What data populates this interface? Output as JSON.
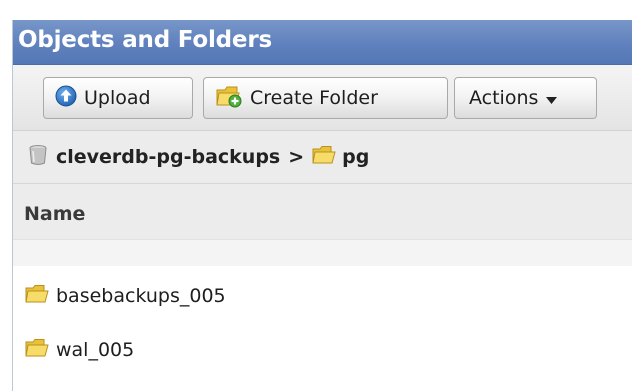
{
  "panel": {
    "title": "Objects and Folders"
  },
  "toolbar": {
    "upload_label": "Upload",
    "create_folder_label": "Create Folder",
    "actions_label": "Actions"
  },
  "breadcrumb": {
    "bucket": "cleverdb-pg-backups",
    "separator": ">",
    "folder": "pg"
  },
  "table": {
    "columns": [
      "Name"
    ],
    "rows": [
      {
        "name": "basebackups_005"
      },
      {
        "name": "wal_005"
      }
    ]
  },
  "colors": {
    "title_bar": "#5f81bd",
    "folder": "#f2cf3f",
    "upload_icon": "#2f78c4"
  }
}
